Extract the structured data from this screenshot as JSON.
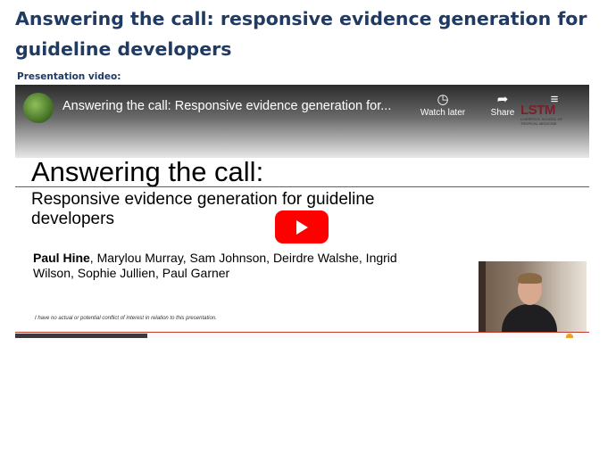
{
  "page": {
    "title": "Answering the call: responsive evidence generation for guideline developers",
    "video_label": "Presentation video:"
  },
  "player": {
    "video_title": "Answering the call: Responsive evidence generation for...",
    "watch_later_label": "Watch later",
    "share_label": "Share",
    "logo_text": "LSTM",
    "logo_sub": "LIVERPOOL SCHOOL OF TROPICAL MEDICINE",
    "icons": [
      "clock-icon",
      "share-arrow-icon",
      "playlist-icon",
      "youtube-play-icon"
    ],
    "play_button_color": "#ff0000"
  },
  "slide": {
    "title": "Answering the call:",
    "subtitle": "Responsive evidence generation for guideline developers",
    "lead_author": "Paul Hine",
    "coauthors": ", Marylou Murray, Sam Johnson, Deirdre Walshe, Ingrid Wilson, Sophie Jullien, Paul Garner",
    "disclaimer": "I have no actual or potential conflict of interest in relation to this presentation.",
    "accent_color": "#c0392b"
  }
}
